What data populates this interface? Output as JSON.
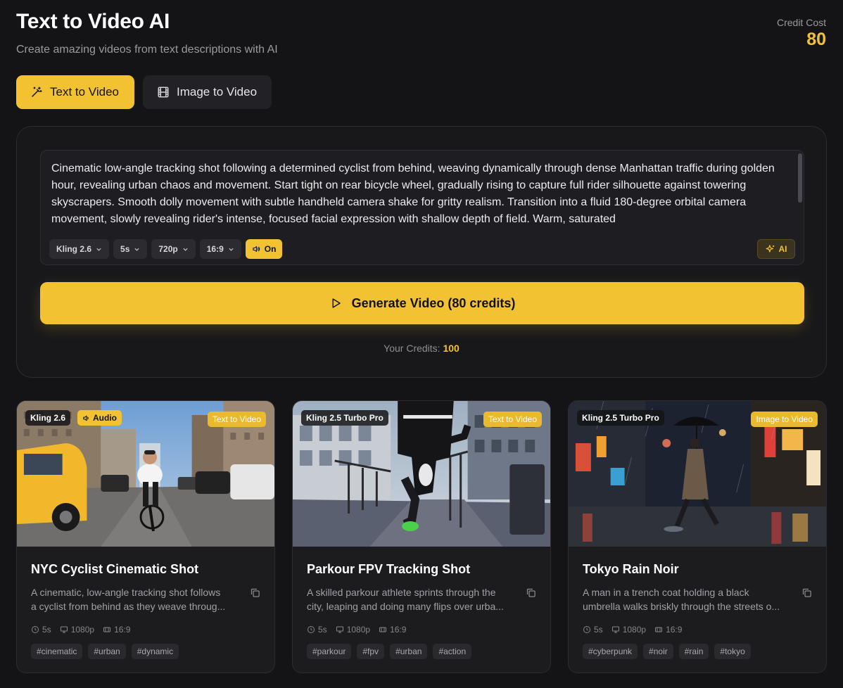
{
  "header": {
    "title": "Text to Video AI",
    "subtitle": "Create amazing videos from text descriptions with AI",
    "credit_cost_label": "Credit Cost",
    "credit_cost_value": "80"
  },
  "tabs": [
    {
      "label": "Text to Video",
      "icon": "magic-wand-icon",
      "active": true
    },
    {
      "label": "Image to Video",
      "icon": "film-icon",
      "active": false
    }
  ],
  "prompt": {
    "text": "Cinematic low-angle tracking shot following a determined cyclist from behind, weaving dynamically through dense Manhattan traffic during golden hour, revealing urban chaos and movement. Start tight on rear bicycle wheel, gradually rising to capture full rider silhouette against towering skyscrapers. Smooth dolly movement with subtle handheld camera shake for gritty realism. Transition into a fluid 180-degree orbital camera movement, slowly revealing rider's intense, focused facial expression with shallow depth of field. Warm, saturated"
  },
  "options": {
    "model": "Kling 2.6",
    "duration": "5s",
    "resolution": "720p",
    "aspect": "16:9",
    "audio": "On",
    "ai_label": "AI"
  },
  "generate": {
    "label": "Generate Video (80 credits)"
  },
  "credits": {
    "label": "Your Credits:",
    "value": "100"
  },
  "cards": [
    {
      "model": "Kling 2.6",
      "audio": "Audio",
      "type": "Text to Video",
      "title": "NYC Cyclist Cinematic Shot",
      "desc1": "A cinematic, low-angle tracking shot follows",
      "desc2": "a cyclist from behind as they weave throug...",
      "duration": "5s",
      "resolution": "1080p",
      "aspect": "16:9",
      "tags": [
        "#cinematic",
        "#urban",
        "#dynamic"
      ]
    },
    {
      "model": "Kling 2.5 Turbo Pro",
      "type": "Text to Video",
      "title": "Parkour FPV Tracking Shot",
      "desc1": "A skilled parkour athlete sprints through the",
      "desc2": "city, leaping and doing many flips over urba...",
      "duration": "5s",
      "resolution": "1080p",
      "aspect": "16:9",
      "tags": [
        "#parkour",
        "#fpv",
        "#urban",
        "#action"
      ]
    },
    {
      "model": "Kling 2.5 Turbo Pro",
      "type": "Image to Video",
      "title": "Tokyo Rain Noir",
      "desc1": "A man in a trench coat holding a black",
      "desc2": "umbrella walks briskly through the streets o...",
      "duration": "5s",
      "resolution": "1080p",
      "aspect": "16:9",
      "tags": [
        "#cyberpunk",
        "#noir",
        "#rain",
        "#tokyo"
      ]
    }
  ],
  "colors": {
    "accent": "#f2c233",
    "background": "#141416",
    "panel": "#18181b"
  }
}
